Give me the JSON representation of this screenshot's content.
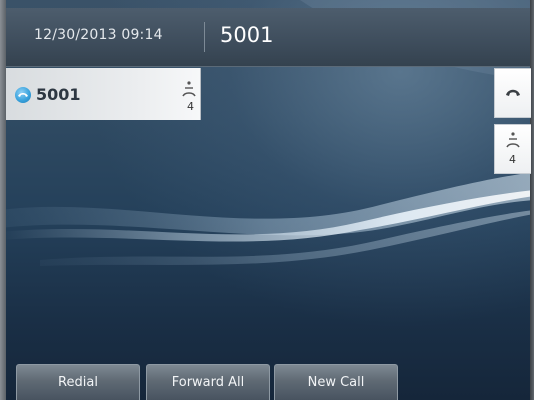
{
  "header": {
    "datetime": "12/30/2013 09:14",
    "extension": "5001"
  },
  "line": {
    "label": "5001",
    "speed_dial_count": "4",
    "icon": "line-status-icon"
  },
  "side_buttons": [
    {
      "icon": "handset-icon"
    },
    {
      "icon": "speed-dial-icon",
      "count": "4"
    }
  ],
  "softkeys": [
    {
      "label": "Redial"
    },
    {
      "label": "Forward All"
    },
    {
      "label": "New Call"
    }
  ]
}
